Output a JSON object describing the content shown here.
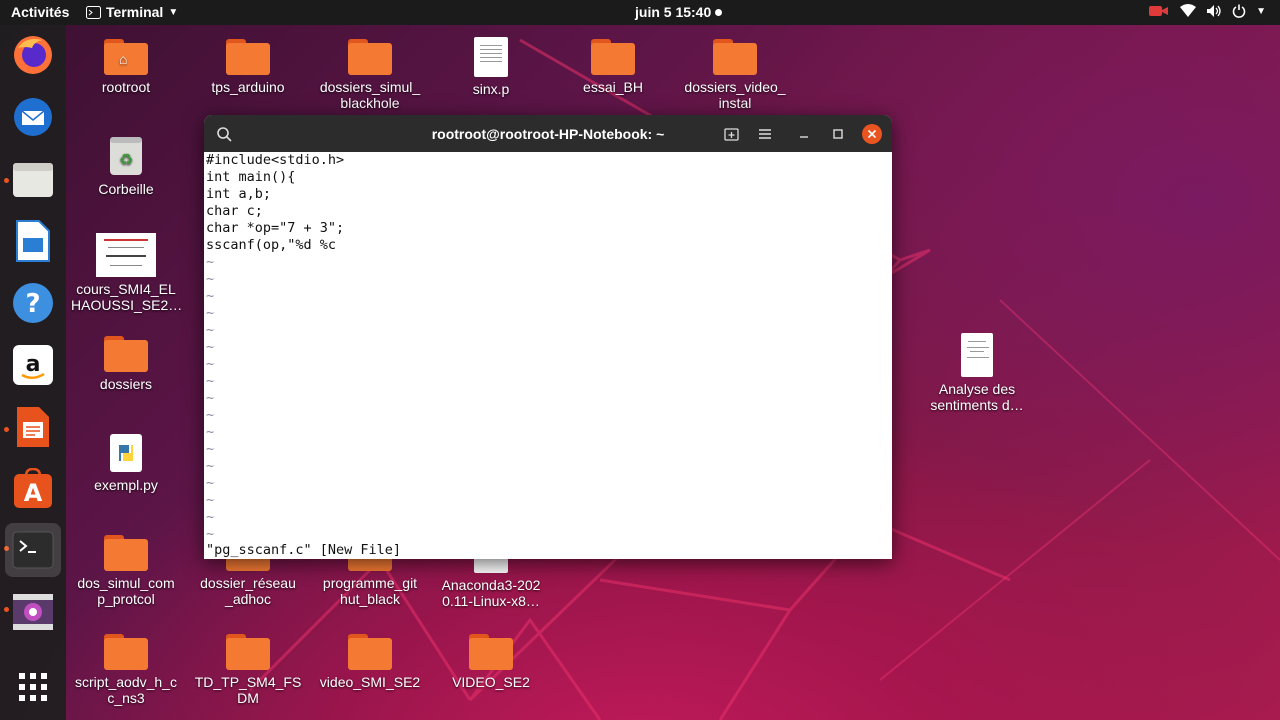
{
  "topbar": {
    "activities": "Activités",
    "app_name": "Terminal",
    "clock": "juin 5  15:40"
  },
  "desktop": {
    "icons": [
      {
        "label": "rootroot",
        "type": "home-folder"
      },
      {
        "label": "tps_arduino",
        "type": "folder"
      },
      {
        "label": "dossiers_simul_\nblackhole",
        "type": "folder"
      },
      {
        "label": "sinx.p",
        "type": "file"
      },
      {
        "label": "essai_BH",
        "type": "folder"
      },
      {
        "label": "dossiers_video_\ninstal",
        "type": "folder"
      },
      {
        "label": "Corbeille",
        "type": "trash"
      },
      {
        "label": "cours_SMI4_EL\nHAOUSSI_SE2…",
        "type": "pdf"
      },
      {
        "label": "dossiers",
        "type": "folder"
      },
      {
        "label": "exempl.py",
        "type": "python"
      },
      {
        "label": "dos_simul_com\np_protcol",
        "type": "folder"
      },
      {
        "label": "dossier_réseau\n_adhoc",
        "type": "folder"
      },
      {
        "label": "programme_git\nhut_black",
        "type": "folder"
      },
      {
        "label": "Anaconda3-202\n0.11-Linux-x8…",
        "type": "file"
      },
      {
        "label": "script_aodv_h_c\nc_ns3",
        "type": "folder"
      },
      {
        "label": "TD_TP_SM4_FS\nDM",
        "type": "folder"
      },
      {
        "label": "video_SMI_SE2",
        "type": "folder"
      },
      {
        "label": "VIDEO_SE2",
        "type": "folder"
      },
      {
        "label": "Analyse des\nsentiments d…",
        "type": "document"
      }
    ]
  },
  "terminal": {
    "title": "rootroot@rootroot-HP-Notebook: ~",
    "code_lines": [
      "#include<stdio.h>",
      "int main(){",
      "int a,b;",
      "char c;",
      "char *op=\"7 + 3\";",
      "sscanf(op,\"%d %c"
    ],
    "tilde": "~",
    "status": "\"pg_sscanf.c\" [New File]"
  },
  "dock": {
    "items": [
      "firefox-icon",
      "thunderbird-icon",
      "files-icon",
      "writer-icon",
      "help-icon",
      "amazon-icon",
      "impress-icon",
      "software-icon",
      "terminal-icon",
      "screencast-icon",
      "app-grid-icon"
    ]
  },
  "colors": {
    "accent": "#e95420",
    "folder": "#f47a34",
    "topbar": "#1b1b1b",
    "terminal_header": "#2c2c2c",
    "close_button": "#e95420"
  }
}
